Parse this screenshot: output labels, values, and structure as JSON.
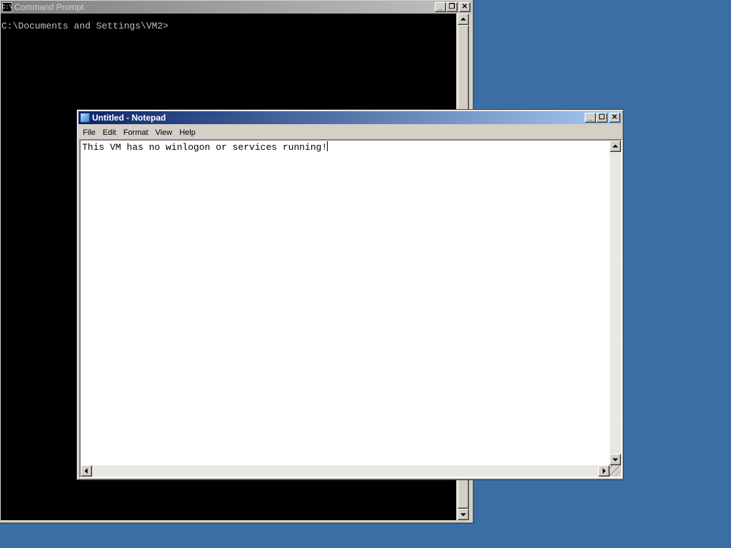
{
  "desktop": {
    "background": "#3a6ea5"
  },
  "cmd": {
    "title": "Command Prompt",
    "icon_label": "C:\\",
    "prompt_line": "C:\\Documents and Settings\\VM2>",
    "buttons": {
      "minimize": "_",
      "restore": "❐",
      "close": "✕"
    }
  },
  "notepad": {
    "title": "Untitled - Notepad",
    "menu": [
      "File",
      "Edit",
      "Format",
      "View",
      "Help"
    ],
    "text": "This VM has no winlogon or services running!",
    "buttons": {
      "minimize": "_",
      "maximize": "☐",
      "close": "✕"
    }
  }
}
